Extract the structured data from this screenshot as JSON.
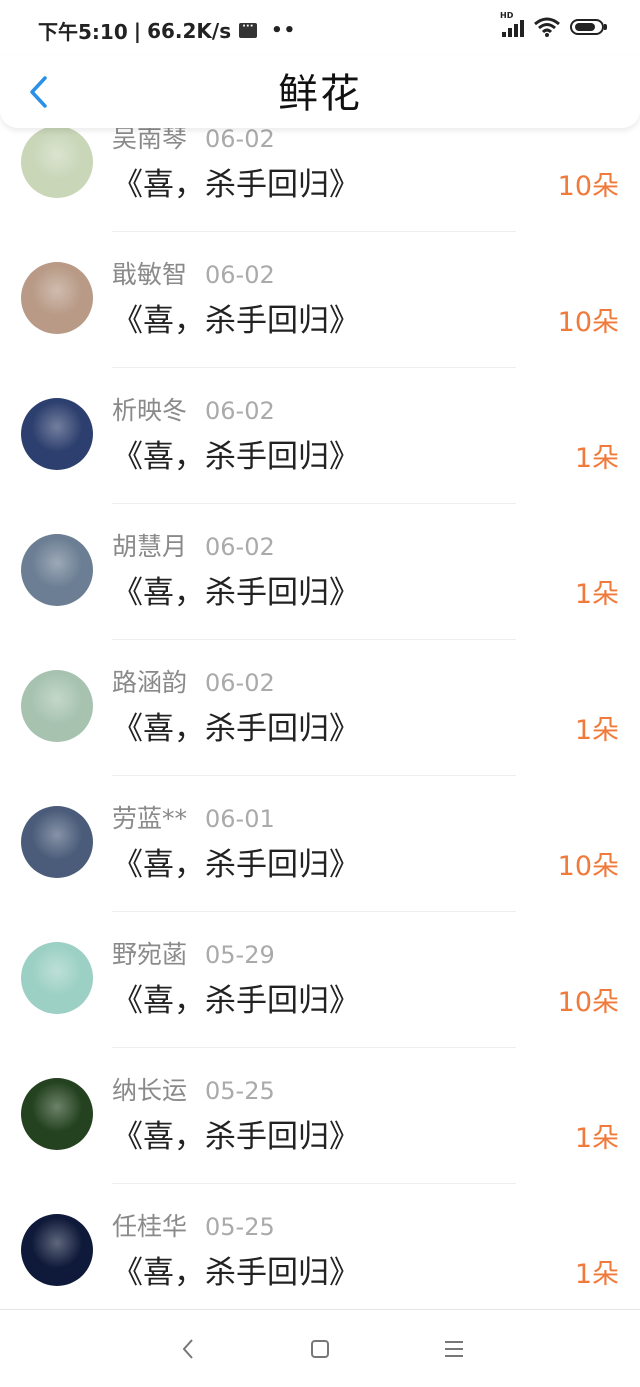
{
  "status_bar": {
    "time": "下午5:10",
    "speed": "66.2K/s",
    "signal_label": "HD",
    "battery_level": 0.7
  },
  "header": {
    "title": "鲜花",
    "back_icon": "chevron-left-icon"
  },
  "entries": [
    {
      "name": "吴南琴",
      "date": "06-02",
      "book": "《喜，杀手回归》",
      "count": "10朵",
      "avatar_color": "#c9d6b8"
    },
    {
      "name": "戢敏智",
      "date": "06-02",
      "book": "《喜，杀手回归》",
      "count": "10朵",
      "avatar_color": "#b89a86"
    },
    {
      "name": "析映冬",
      "date": "06-02",
      "book": "《喜，杀手回归》",
      "count": "1朵",
      "avatar_color": "#2d3f6e"
    },
    {
      "name": "胡慧月",
      "date": "06-02",
      "book": "《喜，杀手回归》",
      "count": "1朵",
      "avatar_color": "#6b7e93"
    },
    {
      "name": "路涵韵",
      "date": "06-02",
      "book": "《喜，杀手回归》",
      "count": "1朵",
      "avatar_color": "#a7c3b0"
    },
    {
      "name": "劳蓝**",
      "date": "06-01",
      "book": "《喜，杀手回归》",
      "count": "10朵",
      "avatar_color": "#4a5c7a"
    },
    {
      "name": "野宛菡",
      "date": "05-29",
      "book": "《喜，杀手回归》",
      "count": "10朵",
      "avatar_color": "#9cd0c4"
    },
    {
      "name": "纳长运",
      "date": "05-25",
      "book": "《喜，杀手回归》",
      "count": "1朵",
      "avatar_color": "#24421f"
    },
    {
      "name": "任桂华",
      "date": "05-25",
      "book": "《喜，杀手回归》",
      "count": "1朵",
      "avatar_color": "#0f1a3a"
    }
  ],
  "bottom_nav": {
    "back": "nav-back-icon",
    "home": "nav-home-icon",
    "menu": "nav-menu-icon"
  },
  "colors": {
    "accent_count": "#f07a3a",
    "back_arrow": "#2b90e6"
  }
}
